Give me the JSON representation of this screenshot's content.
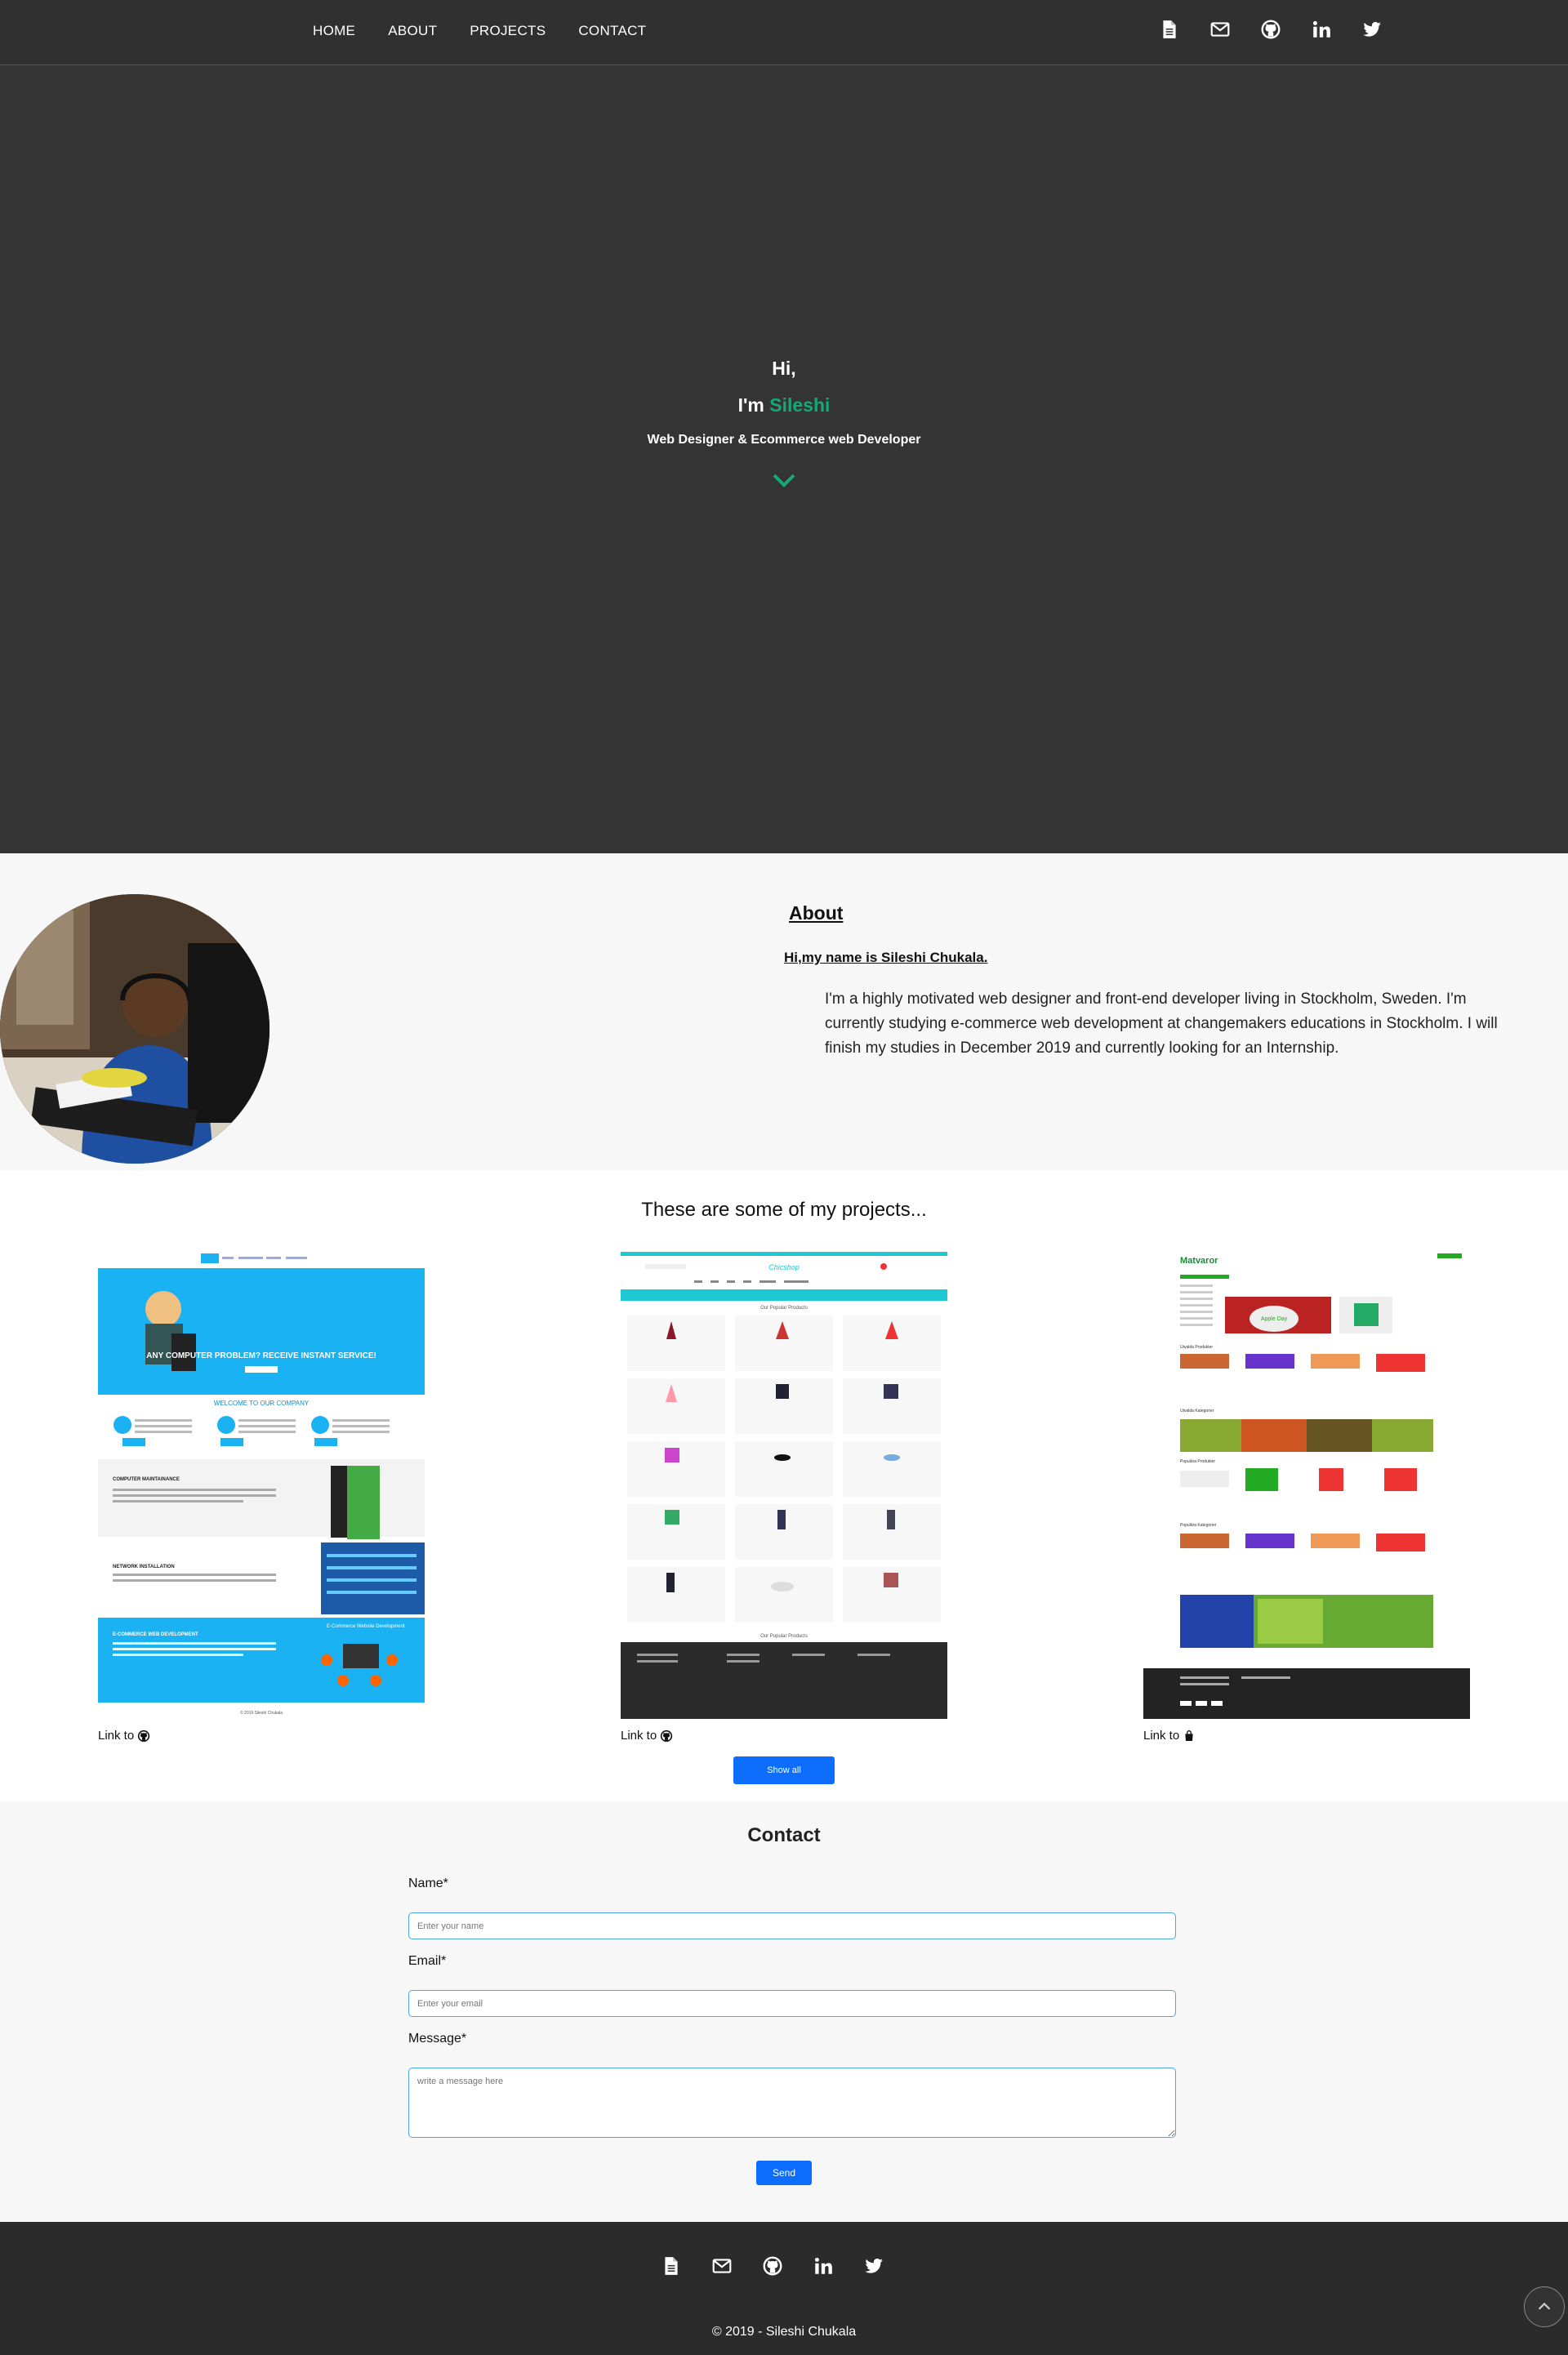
{
  "nav": {
    "links": [
      "HOME",
      "ABOUT",
      "PROJECTS",
      "CONTACT"
    ],
    "icons": [
      "document-icon",
      "mail-icon",
      "github-icon",
      "linkedin-icon",
      "twitter-icon"
    ]
  },
  "hero": {
    "greeting": "Hi,",
    "im": "I'm",
    "name": "Sileshi",
    "role": "Web Designer & Ecommerce web Developer",
    "accent": "#17a876"
  },
  "about": {
    "title": "About",
    "subtitle": "Hi,my name is Sileshi Chukala.",
    "text": "I'm a highly motivated web designer and front-end developer living in Stockholm, Sweden. I'm currently studying e-commerce web development at changemakers educations in Stockholm. I will finish my studies in December 2019 and currently looking for an Internship."
  },
  "projects": {
    "title": "These are some of my projects...",
    "items": [
      {
        "link_text": "Link to",
        "link_icon": "github-icon",
        "banner": "ANY COMPUTER PROBLEM? RECEIVE INSTANT SERVICE!",
        "welcome": "WELCOME TO OUR COMPANY",
        "s1": "COMPUTER MAINTAINANCE",
        "s2": "NETWORK INSTALLATION",
        "s3": "E-COMMERCE WEB DEVELOPMENT",
        "s3b": "E-Commerce Website Development",
        "foot": "© 2019 Sileshi Chukala"
      },
      {
        "link_text": "Link to",
        "link_icon": "github-icon",
        "brand": "Chicshop",
        "heading": "Our Popular Products",
        "bottom": "Our Popular Products"
      },
      {
        "link_text": "Link to",
        "link_icon": "shopping-bag-icon",
        "brand": "Matvaror",
        "h1": "Utvalda Produkter",
        "h2": "Utvalda Kategorier",
        "h3": "Populära Produkter",
        "h4": "Populära Kategorier",
        "promo": "Apple Day"
      }
    ],
    "show_all": "Show all"
  },
  "contact": {
    "title": "Contact",
    "name_label": "Name*",
    "name_placeholder": "Enter your name",
    "email_label": "Email*",
    "email_placeholder": "Enter your email",
    "message_label": "Message*",
    "message_placeholder": "write a message here",
    "send": "Send"
  },
  "footer": {
    "copyright": "© 2019 - Sileshi Chukala"
  },
  "colors": {
    "accent_green": "#17a876",
    "primary_blue": "#0d6efd",
    "dark": "#343434",
    "sky": "#1ab2f2"
  }
}
